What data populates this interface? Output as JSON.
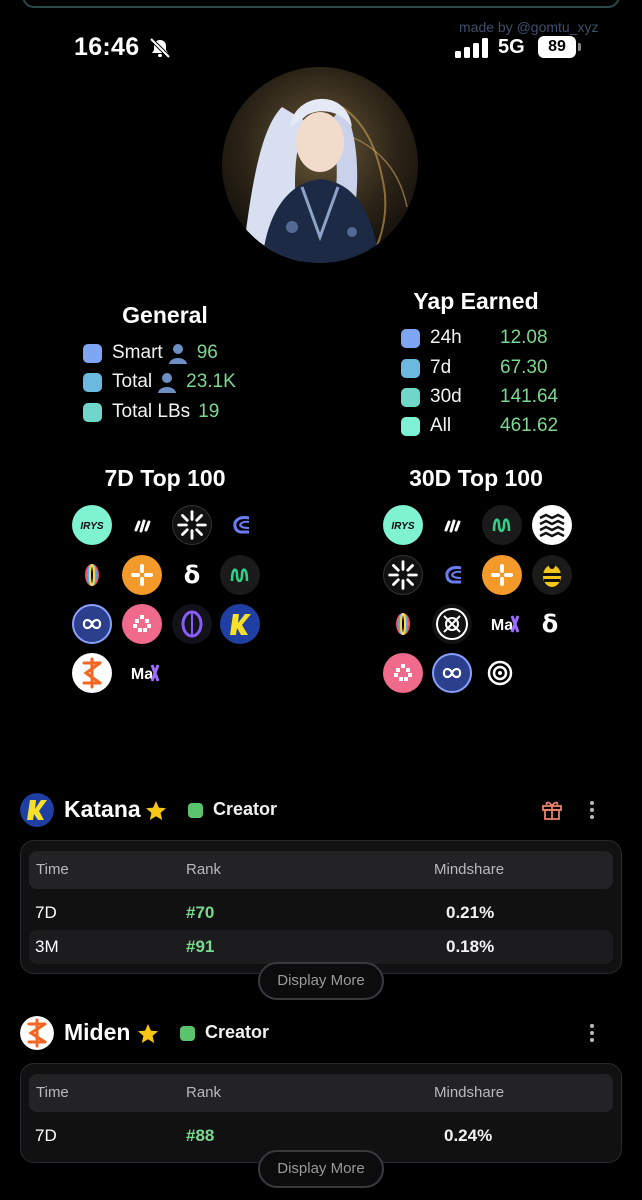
{
  "watermark": "made by @gomtu_xyz",
  "status_bar": {
    "time": "16:46",
    "network": "5G",
    "battery": "89"
  },
  "general": {
    "title": "General",
    "rows": [
      {
        "label": "Smart",
        "value": "96",
        "color": "#7ea6f2"
      },
      {
        "label": "Total",
        "value": "23.1K",
        "color": "#6cb9e0"
      },
      {
        "label": "Total LBs",
        "value": "19",
        "color": "#6fd6c9"
      }
    ]
  },
  "yap": {
    "title": "Yap Earned",
    "rows": [
      {
        "label": "24h",
        "value": "12.08",
        "color": "#7ea6f2"
      },
      {
        "label": "7d",
        "value": "67.30",
        "color": "#6cb9e0"
      },
      {
        "label": "30d",
        "value": "141.64",
        "color": "#6fd6c9"
      },
      {
        "label": "All",
        "value": "461.62",
        "color": "#7ff2d6"
      }
    ]
  },
  "top7d": {
    "title": "7D Top 100",
    "icons": [
      "irys-logo",
      "slash-logo",
      "sunburst-logo",
      "c-arc-logo",
      "rainbow-ring-logo",
      "orange-cross-logo",
      "delta-logo",
      "green-wave-logo",
      "infinity-logo",
      "pink-dots-logo",
      "purple-orb-logo",
      "katana-logo",
      "miden-logo",
      "max-logo"
    ]
  },
  "top30d": {
    "title": "30D Top 100",
    "icons": [
      "irys-logo",
      "slash-logo",
      "green-wave-logo",
      "zigzag-logo",
      "sunburst-logo",
      "c-arc-logo",
      "orange-cross-logo",
      "bee-logo",
      "rainbow-ring-logo",
      "x-circle-logo",
      "max-logo",
      "delta-logo",
      "pink-dots-logo",
      "infinity-logo",
      "target-logo"
    ]
  },
  "projects": [
    {
      "name": "Katana",
      "badge": "Creator",
      "columns": [
        "Time",
        "Rank",
        "Mindshare"
      ],
      "rows": [
        {
          "time": "7D",
          "rank": "#70",
          "share": "0.21%"
        },
        {
          "time": "3M",
          "rank": "#91",
          "share": "0.18%"
        }
      ],
      "more": "Display More"
    },
    {
      "name": "Miden",
      "badge": "Creator",
      "columns": [
        "Time",
        "Rank",
        "Mindshare"
      ],
      "rows": [
        {
          "time": "7D",
          "rank": "#88",
          "share": "0.24%"
        }
      ],
      "more": "Display More"
    }
  ]
}
